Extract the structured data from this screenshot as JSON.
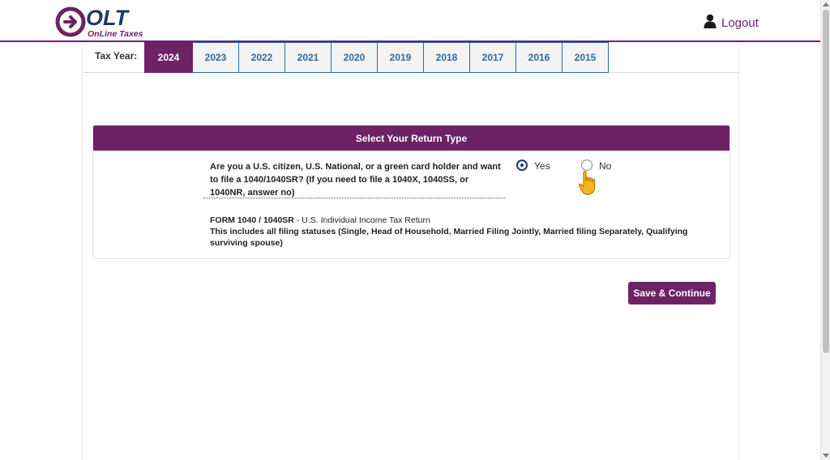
{
  "header": {
    "logo_text": "OLT",
    "logo_tagline": "OnLine Taxes",
    "logout_label": "Logout",
    "logout_icon": "user-icon"
  },
  "tax_year": {
    "label": "Tax Year:",
    "tabs": [
      "2024",
      "2023",
      "2022",
      "2021",
      "2020",
      "2019",
      "2018",
      "2017",
      "2016",
      "2015"
    ],
    "selected": "2024"
  },
  "panel": {
    "title": "Select Your Return Type",
    "question": "Are you a U.S. citizen, U.S. National, or a green card holder and want to file a 1040/1040SR? (If you need to file a 1040X, 1040SS, or 1040NR, answer no)",
    "options": {
      "yes_label": "Yes",
      "no_label": "No",
      "selected": "Yes"
    },
    "form": {
      "name": "FORM 1040 / 1040SR",
      "separator": " - ",
      "description": "U.S. Individual Income Tax Return",
      "note": "This includes all filing statuses (Single, Head of Household, Married Filing Jointly, Married filing Separately, Qualifying surviving spouse)"
    }
  },
  "actions": {
    "save_label": "Save & Continue"
  },
  "colors": {
    "brand": "#6d2266",
    "tab_link": "#2a6aa6",
    "logo_navy": "#1e3a66"
  }
}
